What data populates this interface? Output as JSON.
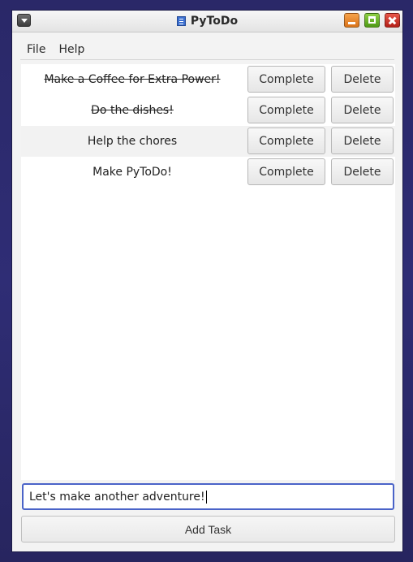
{
  "window": {
    "title": "PyToDo",
    "icon": "app-icon",
    "controls": [
      "minimize-icon",
      "maximize-icon",
      "close-icon"
    ]
  },
  "menubar": {
    "file_label": "File",
    "help_label": "Help"
  },
  "tasks": [
    {
      "label": "Make a Coffee for Extra Power!",
      "completed": true,
      "complete_label": "Complete",
      "delete_label": "Delete"
    },
    {
      "label": "Do the dishes!",
      "completed": true,
      "complete_label": "Complete",
      "delete_label": "Delete"
    },
    {
      "label": "Help the chores",
      "completed": false,
      "complete_label": "Complete",
      "delete_label": "Delete"
    },
    {
      "label": "Make PyToDo!",
      "completed": false,
      "complete_label": "Complete",
      "delete_label": "Delete"
    }
  ],
  "new_task": {
    "value": "Let's make another adventure!"
  },
  "add_task_label": "Add Task",
  "colors": {
    "accent_focus": "#4a63c8",
    "close": "#c9362b",
    "maximize": "#6bb22b",
    "minimize": "#e98b2f"
  }
}
